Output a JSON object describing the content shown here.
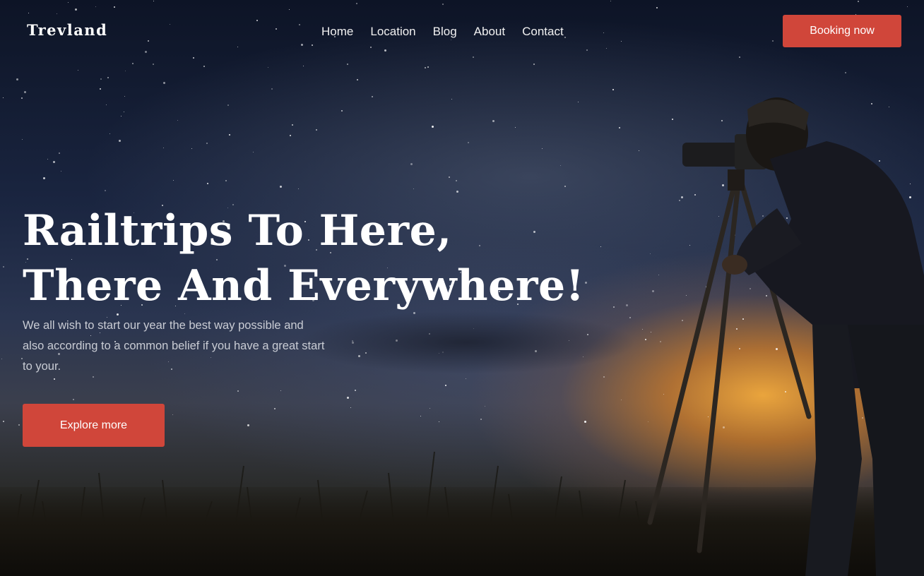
{
  "brand": {
    "logo": "Trevland"
  },
  "nav": {
    "items": [
      {
        "label": "Home"
      },
      {
        "label": "Location"
      },
      {
        "label": "Blog"
      },
      {
        "label": "About"
      },
      {
        "label": "Contact"
      }
    ],
    "cta_label": "Booking now"
  },
  "hero": {
    "headline_line1": "Railtrips To Here,",
    "headline_line2": "There And Everywhere!",
    "description": "We all wish to start our year the best way possible and also according to a common belief if you have a great start to your.",
    "cta_label": "Explore more",
    "background_image": "night-sky-photographer-with-camera-on-tripod"
  },
  "colors": {
    "accent": "#d0463a",
    "text_primary": "#ffffff",
    "text_muted": "#c9ccd4"
  }
}
